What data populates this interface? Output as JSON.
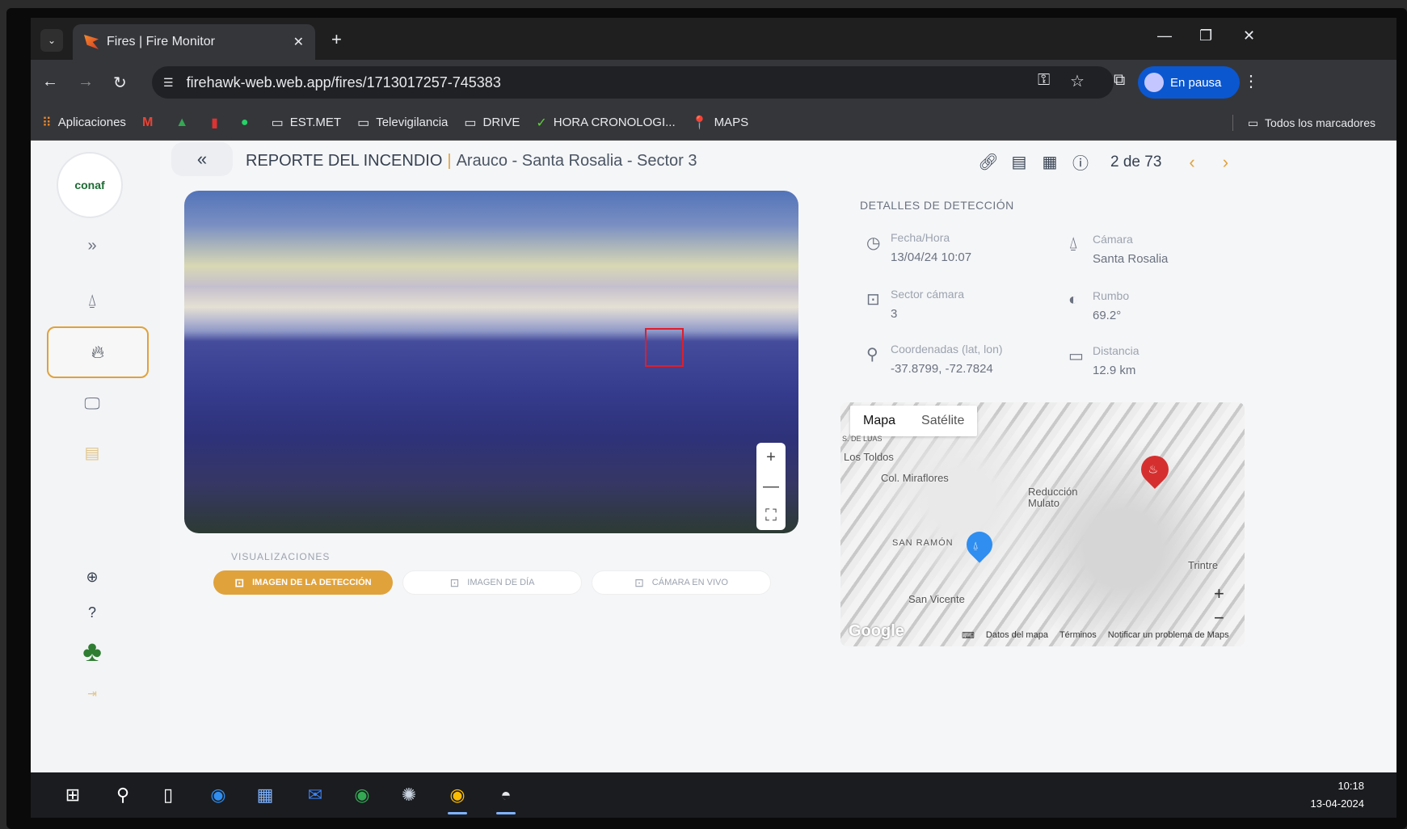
{
  "browser": {
    "tab_title": "Fires | Fire Monitor",
    "url": "firehawk-web.web.app/fires/1713017257-745383",
    "profile_label": "En pausa",
    "bookmarks": [
      "Aplicaciones",
      "EST.MET",
      "Televigilancia",
      "DRIVE",
      "HORA CRONOLOGI...",
      "MAPS"
    ],
    "all_bookmarks": "Todos los marcadores"
  },
  "header": {
    "title": "REPORTE DEL INCENDIO",
    "subtitle": "Arauco - Santa Rosalia - Sector 3",
    "pager": "2 de 73"
  },
  "logo": {
    "text": "conaf"
  },
  "visualizations": {
    "label": "VISUALIZACIONES",
    "buttons": [
      "IMAGEN DE LA DETECCIÓN",
      "IMAGEN DE DÍA",
      "CÁMARA EN VIVO"
    ]
  },
  "details": {
    "title": "DETALLES DE DETECCIÓN",
    "fecha_label": "Fecha/Hora",
    "fecha_value": "13/04/24 10:07",
    "camara_label": "Cámara",
    "camara_value": "Santa Rosalia",
    "sector_label": "Sector cámara",
    "sector_value": "3",
    "rumbo_label": "Rumbo",
    "rumbo_value": "69.2°",
    "coord_label": "Coordenadas (lat, lon)",
    "coord_value": "-37.8799, -72.7824",
    "dist_label": "Distancia",
    "dist_value": "12.9 km"
  },
  "map": {
    "tabs": [
      "Mapa",
      "Satélite"
    ],
    "places": [
      "Los Toldos",
      "Col. Miraflores",
      "Reducción Mulato",
      "SAN RAMÓN",
      "San Vicente",
      "Trintre",
      "S. DE LUAS"
    ],
    "logo": "Google",
    "footer": [
      "Datos del mapa",
      "Términos",
      "Notificar un problema de Maps"
    ]
  },
  "taskbar": {
    "time": "10:18",
    "date": "13-04-2024"
  },
  "colors": {
    "accent": "#e0a23b",
    "detection_box": "#e11d2a",
    "fire_pin": "#d62f2f",
    "camera_pin": "#2f8ef0"
  }
}
